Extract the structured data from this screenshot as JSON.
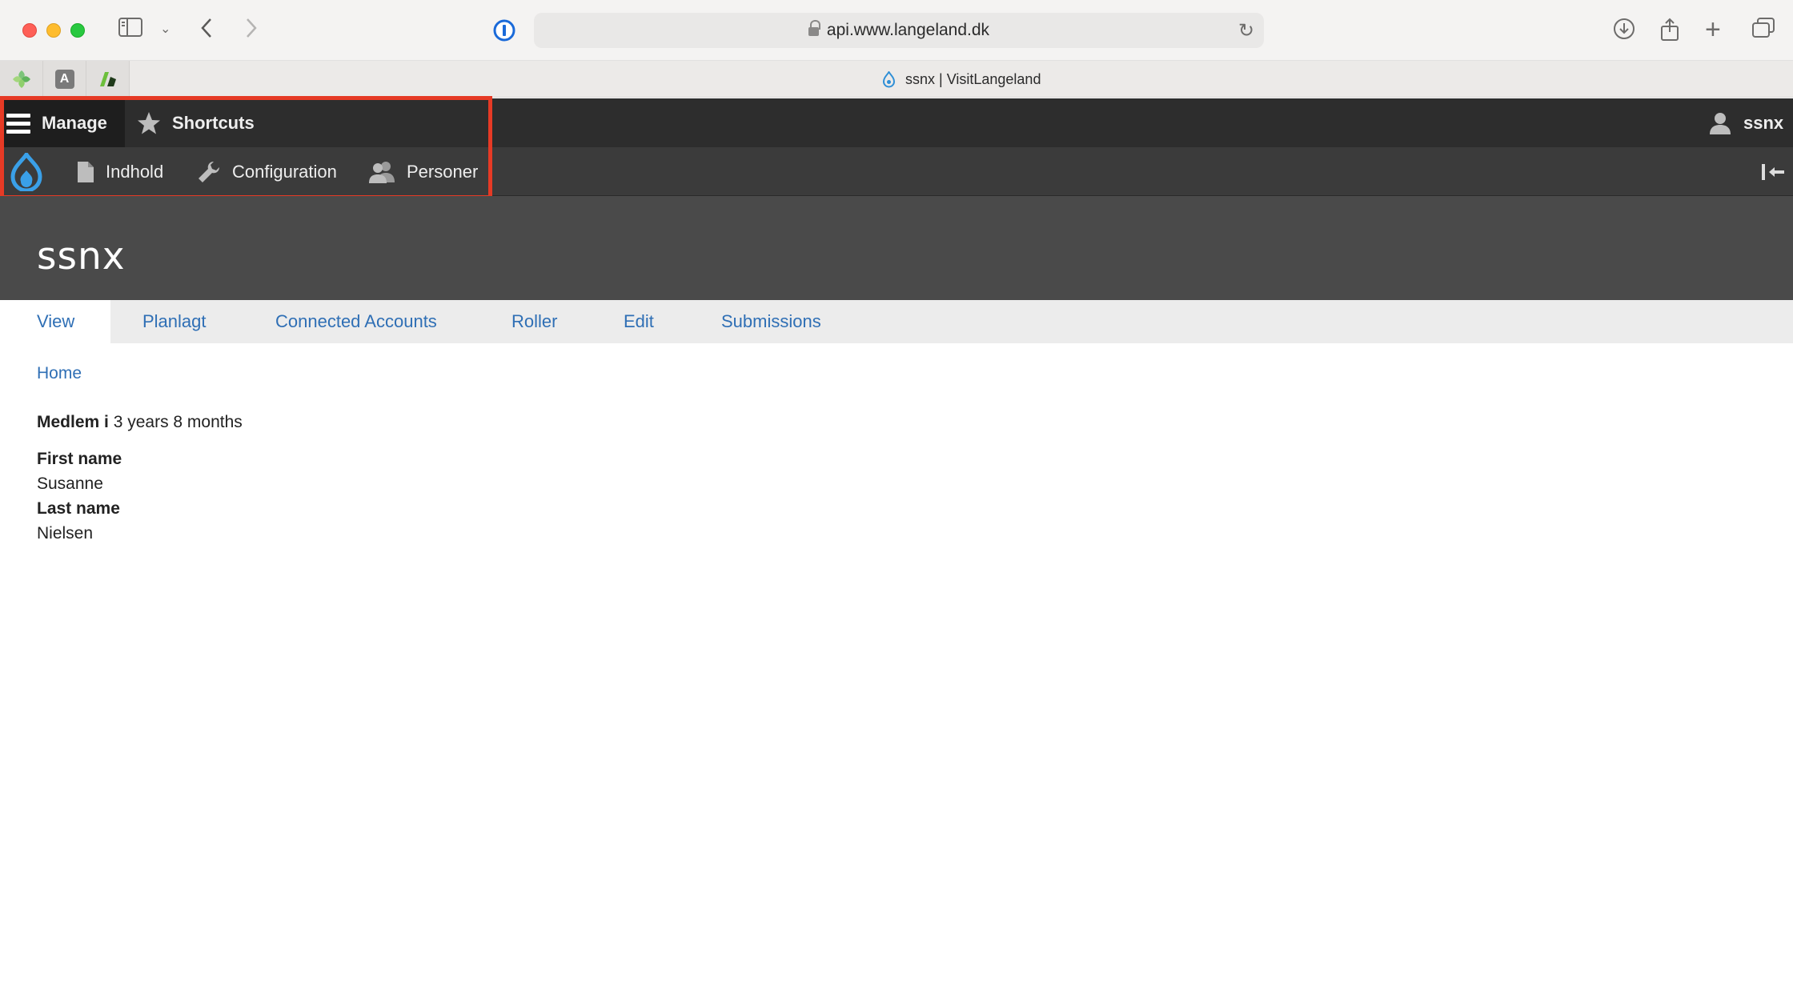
{
  "browser": {
    "url": "api.www.langeland.dk",
    "tab_title": "ssnx | VisitLangeland",
    "pinned_tabs": [
      "green-leaf-icon",
      "a-letter-icon",
      "green-tag-icon"
    ],
    "pinned_a_letter": "A"
  },
  "toolbar": {
    "manage_label": "Manage",
    "shortcuts_label": "Shortcuts",
    "user_label": "ssnx",
    "tray_items": [
      "Indhold",
      "Configuration",
      "Personer"
    ]
  },
  "page": {
    "title": "ssnx",
    "tabs": [
      "View",
      "Planlagt",
      "Connected Accounts",
      "Roller",
      "Edit",
      "Submissions"
    ],
    "active_tab": "View",
    "breadcrumb": "Home"
  },
  "profile": {
    "member_label": "Medlem i",
    "member_value": "3 years 8 months",
    "first_name_label": "First name",
    "first_name_value": "Susanne",
    "last_name_label": "Last name",
    "last_name_value": "Nielsen"
  },
  "colors": {
    "accent_link": "#2f6fb5",
    "toolbar_dark": "#2d2d2d",
    "highlight": "#e63a25"
  }
}
